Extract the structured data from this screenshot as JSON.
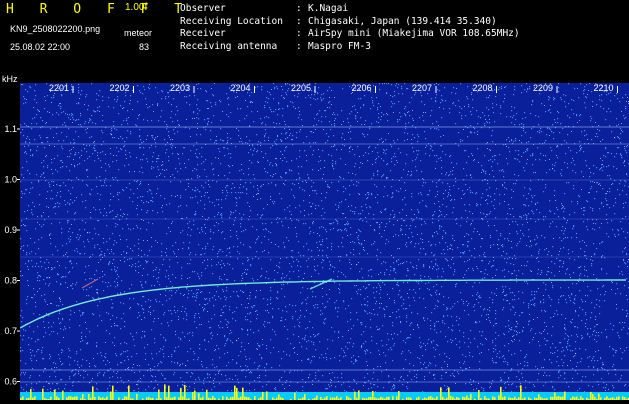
{
  "header": {
    "brand": "H R O F F T",
    "version": "1.00f",
    "filename": "KN9_2508022200.png",
    "timestamp": "25.08.02 22:00",
    "meteor_label": "meteor",
    "meteor_count": "83"
  },
  "info": [
    {
      "label": "Observer",
      "sep": ":",
      "value": "K.Nagai"
    },
    {
      "label": "Receiving Location",
      "sep": ":",
      "value": "Chigasaki, Japan (139.414 35.340)"
    },
    {
      "label": "Receiver",
      "sep": ":",
      "value": "AirSpy mini (Miakejima VOR 108.65MHz)"
    },
    {
      "label": "Receiving antenna",
      "sep": ":",
      "value": "Maspro FM-3"
    }
  ],
  "plot": {
    "unit_label": "kHz",
    "y_ticks": [
      "1.1",
      "1.0",
      "0.9",
      "0.8",
      "0.7",
      "0.6"
    ],
    "x_ticks": [
      "2201",
      "2202",
      "2203",
      "2204",
      "2205",
      "2206",
      "2207",
      "2208",
      "2209",
      "2210"
    ],
    "colors": {
      "background": "#0a1f9a",
      "noise": "#5aa6ff",
      "signal": "#7fffe0",
      "baseline": "#00ccff",
      "meteor_burst": "#ffff00"
    }
  }
}
